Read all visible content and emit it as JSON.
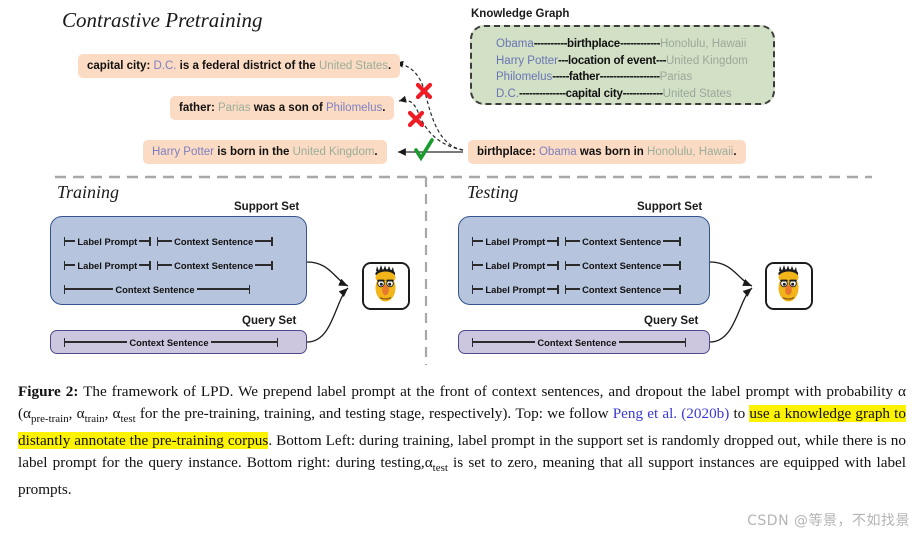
{
  "figure": {
    "sections": {
      "contrastive_pretraining": "Contrastive Pretraining",
      "training": "Training",
      "testing": "Testing"
    },
    "knowledge_graph": {
      "title": "Knowledge Graph",
      "box_color": "#d2e0c6",
      "head_color": "#6a73b4",
      "tail_color": "#9aa89a",
      "triples": [
        {
          "head": "Obama",
          "dash_left": "----------",
          "relation": "birthplace",
          "dash_right": "------------",
          "tail": "Honolulu, Hawaii"
        },
        {
          "head": "Harry Potter",
          "dash_left": "---",
          "relation": "location of event",
          "dash_right": "---",
          "tail": "United Kingdom"
        },
        {
          "head": "Philomelus",
          "dash_left": "-----",
          "relation": "father",
          "dash_right": "------------------",
          "tail": "Parias"
        },
        {
          "head": "D.C.",
          "dash_left": "--------------",
          "relation": "capital city",
          "dash_right": "------------",
          "tail": "United States"
        }
      ]
    },
    "sentences": [
      {
        "id": "capital-city",
        "label": "capital city:",
        "parts": [
          {
            "text": " D.C.",
            "style": "entity-blue"
          },
          {
            "text": " is a federal district of the ",
            "style": "plain"
          },
          {
            "text": "United States",
            "style": "entity-green"
          },
          {
            "text": ".",
            "style": "plain"
          }
        ],
        "mark": "cross"
      },
      {
        "id": "father",
        "label": "father:",
        "parts": [
          {
            "text": " Parias",
            "style": "entity-green"
          },
          {
            "text": " was a son of ",
            "style": "plain"
          },
          {
            "text": "Philomelus",
            "style": "entity-blue"
          },
          {
            "text": ".",
            "style": "plain"
          }
        ],
        "mark": "cross"
      },
      {
        "id": "harry-potter",
        "label": "",
        "parts": [
          {
            "text": "Harry Potter",
            "style": "entity-blue"
          },
          {
            "text": " is born in the ",
            "style": "plain"
          },
          {
            "text": "United Kingdom",
            "style": "entity-green"
          },
          {
            "text": ".",
            "style": "plain"
          }
        ],
        "mark": "check"
      },
      {
        "id": "birthplace",
        "label": "birthplace:",
        "parts": [
          {
            "text": " Obama",
            "style": "entity-blue"
          },
          {
            "text": " was born in ",
            "style": "plain"
          },
          {
            "text": "Honolulu, Hawaii",
            "style": "entity-green"
          },
          {
            "text": ".",
            "style": "plain"
          }
        ],
        "mark": "anchor"
      }
    ],
    "set_labels": {
      "support_set": "Support Set",
      "query_set": "Query Set"
    },
    "segment_labels": {
      "label_prompt": "Label Prompt",
      "context_sentence": "Context Sentence"
    },
    "training": {
      "support_rows": [
        {
          "has_label_prompt": true,
          "label_prompt": "Label Prompt",
          "context": "Context Sentence"
        },
        {
          "has_label_prompt": true,
          "label_prompt": "Label Prompt",
          "context": "Context Sentence"
        },
        {
          "has_label_prompt": false,
          "label_prompt": "",
          "context": "Context Sentence"
        }
      ],
      "query_rows": [
        {
          "has_label_prompt": false,
          "label_prompt": "",
          "context": "Context Sentence"
        }
      ]
    },
    "testing": {
      "support_rows": [
        {
          "has_label_prompt": true,
          "label_prompt": "Label Prompt",
          "context": "Context Sentence"
        },
        {
          "has_label_prompt": true,
          "label_prompt": "Label Prompt",
          "context": "Context Sentence"
        },
        {
          "has_label_prompt": true,
          "label_prompt": "Label Prompt",
          "context": "Context Sentence"
        }
      ],
      "query_rows": [
        {
          "has_label_prompt": false,
          "label_prompt": "",
          "context": "Context Sentence"
        }
      ]
    },
    "model_icon": "bert-avatar-icon",
    "colors": {
      "support_fill": "#b7c4dd",
      "support_border": "#36538f",
      "query_fill": "#ccc7df",
      "query_border": "#4c4a8c",
      "sentence_fill": "#fbdbc3",
      "kg_fill": "#d2e0c6",
      "cross_mark": "#ee1c25",
      "check_mark": "#1a9b2e",
      "highlight": "#fdf200",
      "citation_link": "#3a3ad0"
    }
  },
  "caption": {
    "prefix": "Figure 2:",
    "line1": " The framework of LPD. We prepend label prompt at the front of context sentences, and dropout the label prompt with probability α (α",
    "sub1": "pre-train",
    "mid1": ", α",
    "sub2": "train",
    "mid2": ", α",
    "sub3": "test",
    "mid3": " for the pre-training, training, and testing stage, respectively). Top: we follow ",
    "citation": "Peng et al. (2020b)",
    "mid4": " to ",
    "highlight": "use a knowledge graph to distantly annotate the pre-training corpus",
    "mid5": ". Bottom Left: during training, label prompt in the support set is randomly dropped out, while there is no label prompt for the query instance. Bottom right: during testing,α",
    "sub4": "test",
    "tail": " is set to zero, meaning that all support instances are equipped with label prompts."
  },
  "watermark": "CSDN @等景，不如找景"
}
